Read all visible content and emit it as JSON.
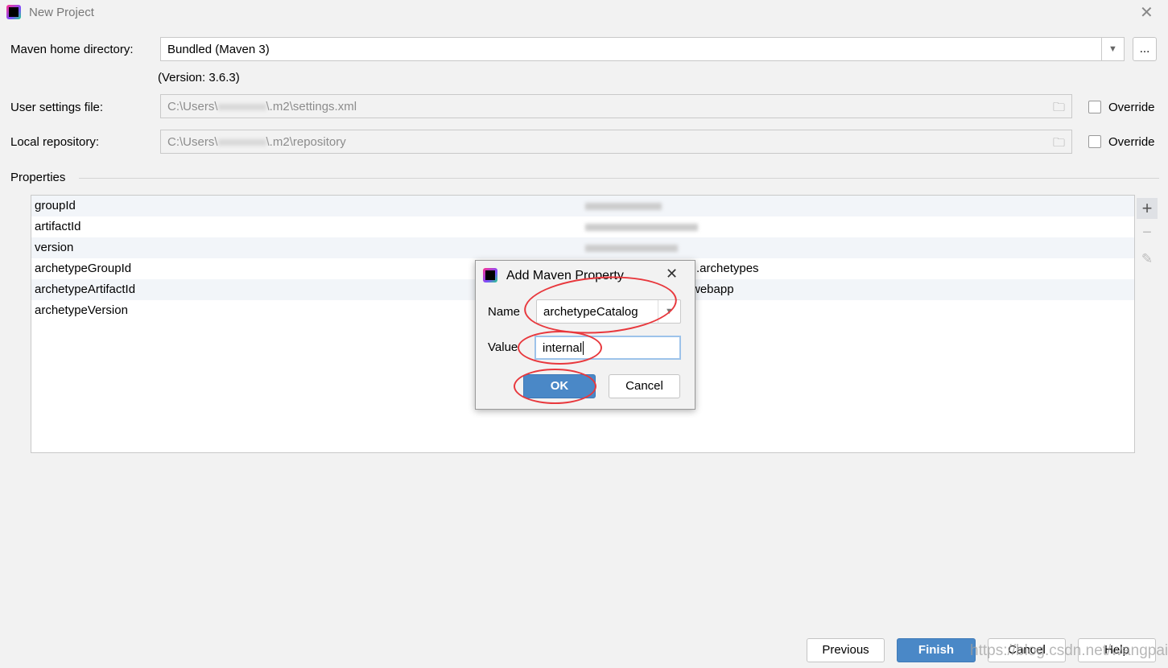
{
  "window": {
    "title": "New Project",
    "close_icon": "close-icon"
  },
  "maven_home": {
    "label": "Maven home directory:",
    "value": "Bundled (Maven 3)",
    "browse": "...",
    "version": "(Version: 3.6.3)"
  },
  "user_settings": {
    "label": "User settings file:",
    "value_prefix": "C:\\Users\\",
    "value_suffix": "\\.m2\\settings.xml",
    "override": "Override"
  },
  "local_repo": {
    "label": "Local repository:",
    "value_prefix": "C:\\Users\\",
    "value_suffix": "\\.m2\\repository",
    "override": "Override"
  },
  "properties": {
    "label": "Properties",
    "rows": [
      {
        "name": "groupId"
      },
      {
        "name": "artifactId"
      },
      {
        "name": "version"
      },
      {
        "name": "archetypeGroupId",
        "value": ".archetypes"
      },
      {
        "name": "archetypeArtifactId",
        "value": "webapp"
      },
      {
        "name": "archetypeVersion"
      }
    ]
  },
  "dialog": {
    "title": "Add Maven Property",
    "name_label": "Name",
    "name_value": "archetypeCatalog",
    "value_label": "Value",
    "value_value": "internal",
    "ok": "OK",
    "cancel": "Cancel"
  },
  "footer": {
    "previous": "Previous",
    "finish": "Finish",
    "cancel": "Cancel",
    "help": "Help"
  },
  "watermark": "https://blog.csdn.net/wangpaiblog",
  "colors": {
    "primary": "#4a88c7",
    "annotation": "#e8383d"
  }
}
